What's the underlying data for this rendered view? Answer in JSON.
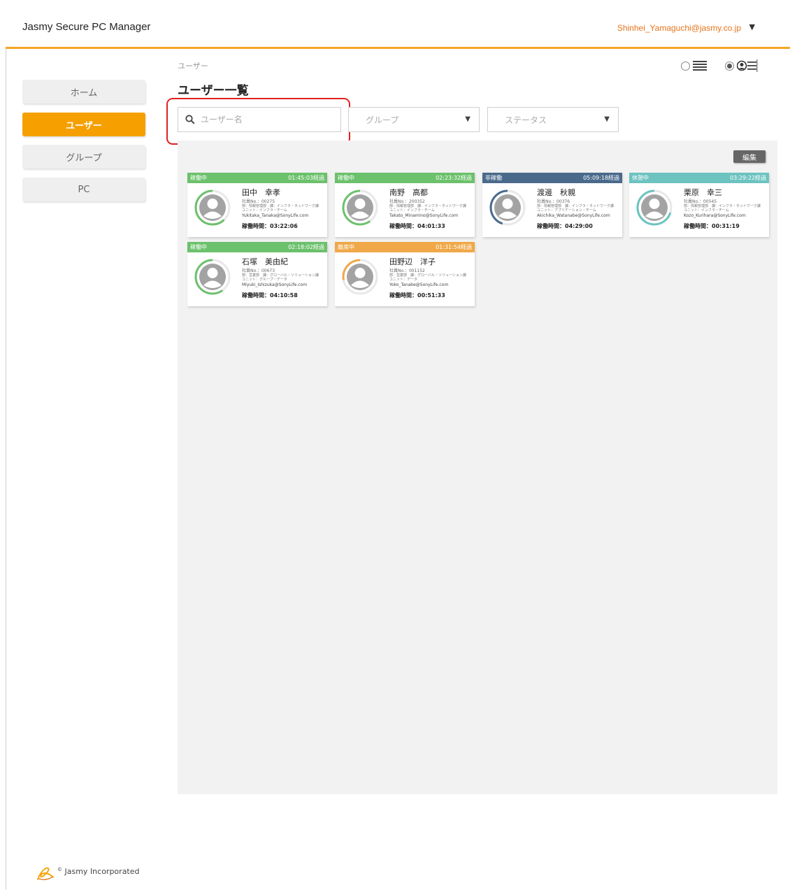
{
  "app": {
    "title": "Jasmy Secure PC Manager",
    "user_email": "Shinhei_Yamaguchi@jasmy.co.jp",
    "user_caret": "▼"
  },
  "sidebar": {
    "items": [
      {
        "label": "ホーム"
      },
      {
        "label": "ユーザー",
        "active": true
      },
      {
        "label": "グループ"
      },
      {
        "label": "PC"
      }
    ]
  },
  "main": {
    "breadcrumb": "ユーザー",
    "title": "ユーザー一覧",
    "search": {
      "placeholder": "ユーザー名",
      "value": ""
    },
    "group_filter": {
      "placeholder": "グループ",
      "caret": "▼"
    },
    "status_filter": {
      "placeholder": "ステータス",
      "caret": "▼"
    },
    "edit_label": "編集",
    "view_mode": {
      "list_selected": false,
      "card_selected": true
    }
  },
  "users": [
    {
      "status": "稼働中",
      "elapsed": "01:45:03経過",
      "name": "田中　幸孝",
      "id": "社員No.：00275",
      "dept1": "部：情報管理部　課：インフラ・ネットワーク課",
      "dept2": "ユニット：インフラ・チーム",
      "email": "Yukitaka_Tanaka@SonyLife.com",
      "uptime": "稼働時間：03:22:06",
      "color": "#6cc16c",
      "progress": 0.62
    },
    {
      "status": "稼働中",
      "elapsed": "02:23:32経過",
      "name": "南野　高都",
      "id": "社員No.：200352",
      "dept1": "部：情報管理部　課：インフラ・ネットワーク課",
      "dept2": "ユニット：インフラ・チーム",
      "email": "Takato_Minamino@SonyLife.com",
      "uptime": "稼働時間：04:01:33",
      "color": "#6cc16c",
      "progress": 0.6
    },
    {
      "status": "非稼働",
      "elapsed": "05:09:18経過",
      "name": "渡邊　秋親",
      "id": "社員No.：00376",
      "dept1": "部：情報管理部　課：インフラ・ネットワーク課",
      "dept2": "ユニット：アプリケーション・チーム",
      "email": "Akichika_Watanabe@SonyLife.com",
      "uptime": "稼働時間：04:29:00",
      "color": "#4a6a8c",
      "progress": 0.45
    },
    {
      "status": "休憩中",
      "elapsed": "03:29:22経過",
      "name": "栗原　幸三",
      "id": "社員No.：00545",
      "dept1": "部：情報管理部　課：インフラ・ネットワーク課",
      "dept2": "ユニット：インフラ・チーム",
      "email": "Kozo_Kurihara@SonyLife.com",
      "uptime": "稼働時間：00:31:19",
      "color": "#6cc3c0",
      "progress": 0.7
    },
    {
      "status": "稼働中",
      "elapsed": "02:18:02経過",
      "name": "石塚　美由紀",
      "id": "社員No.：00673",
      "dept1": "部：営業部　課：グローバル・ソリューション課",
      "dept2": "ユニット：グループ・データ",
      "email": "Miyuki_Ishizuka@SonyLife.com",
      "uptime": "稼働時間：04:10:58",
      "color": "#6cc16c",
      "progress": 0.6
    },
    {
      "status": "離席中",
      "elapsed": "01:31:54経過",
      "name": "田野辺　洋子",
      "id": "社員No.：001152",
      "dept1": "部：営業部　課：グローバル・ソリューション課",
      "dept2": "ユニット：データ",
      "email": "Yoko_Tanabe@SonyLife.com",
      "uptime": "稼働時間：00:51:33",
      "color": "#f0a848",
      "progress": 0.28
    }
  ],
  "footer": {
    "copyright_mark": "©",
    "company": "Jasmy Incorporated"
  },
  "colors": {
    "accent": "#f5a000",
    "email": "#e8741c",
    "highlight": "#e02020"
  }
}
